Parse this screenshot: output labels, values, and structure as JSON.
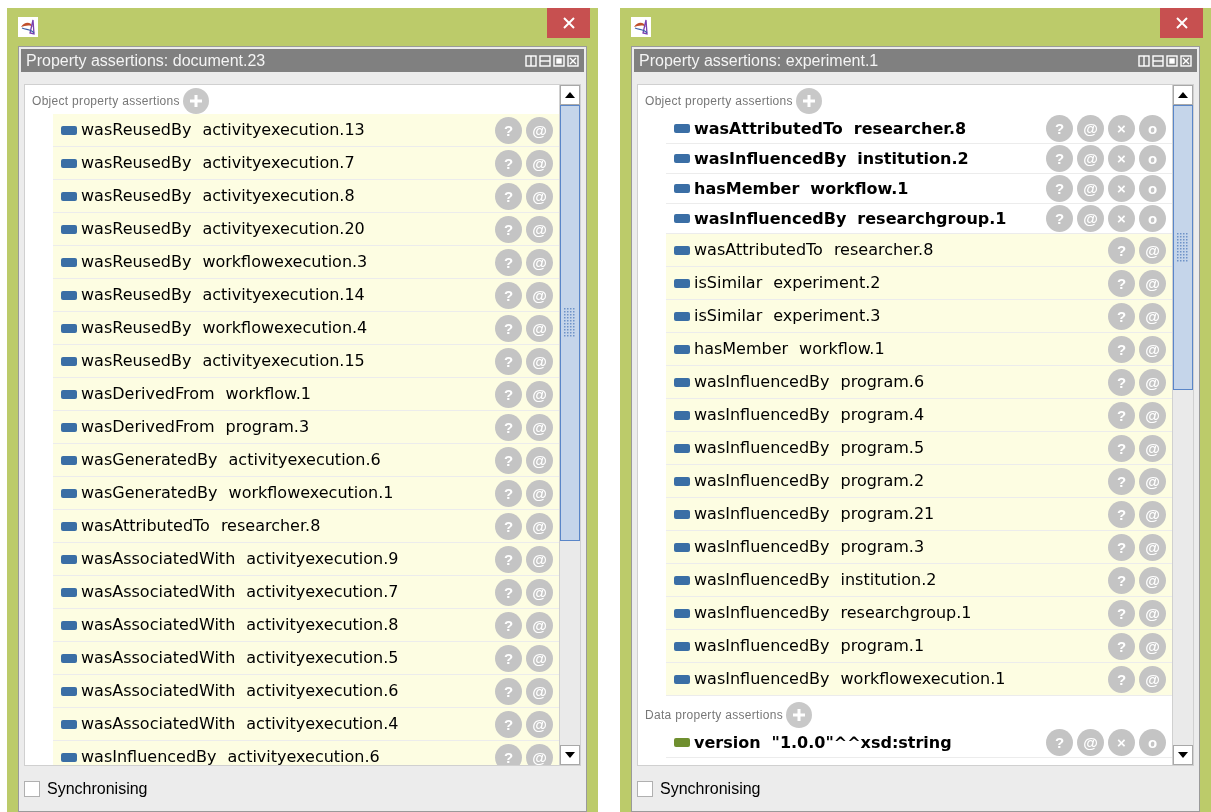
{
  "windows": [
    {
      "title": "Property assertions: document.23",
      "sections": [
        {
          "heading": "Object property assertions",
          "kind": "object",
          "rows": [
            {
              "property": "wasReusedBy",
              "value": "activityexecution.13",
              "asserted": false,
              "buttons": [
                "?",
                "@"
              ]
            },
            {
              "property": "wasReusedBy",
              "value": "activityexecution.7",
              "asserted": false,
              "buttons": [
                "?",
                "@"
              ]
            },
            {
              "property": "wasReusedBy",
              "value": "activityexecution.8",
              "asserted": false,
              "buttons": [
                "?",
                "@"
              ]
            },
            {
              "property": "wasReusedBy",
              "value": "activityexecution.20",
              "asserted": false,
              "buttons": [
                "?",
                "@"
              ]
            },
            {
              "property": "wasReusedBy",
              "value": "workflowexecution.3",
              "asserted": false,
              "buttons": [
                "?",
                "@"
              ]
            },
            {
              "property": "wasReusedBy",
              "value": "activityexecution.14",
              "asserted": false,
              "buttons": [
                "?",
                "@"
              ]
            },
            {
              "property": "wasReusedBy",
              "value": "workflowexecution.4",
              "asserted": false,
              "buttons": [
                "?",
                "@"
              ]
            },
            {
              "property": "wasReusedBy",
              "value": "activityexecution.15",
              "asserted": false,
              "buttons": [
                "?",
                "@"
              ]
            },
            {
              "property": "wasDerivedFrom",
              "value": "workflow.1",
              "asserted": false,
              "buttons": [
                "?",
                "@"
              ]
            },
            {
              "property": "wasDerivedFrom",
              "value": "program.3",
              "asserted": false,
              "buttons": [
                "?",
                "@"
              ]
            },
            {
              "property": "wasGeneratedBy",
              "value": "activityexecution.6",
              "asserted": false,
              "buttons": [
                "?",
                "@"
              ]
            },
            {
              "property": "wasGeneratedBy",
              "value": "workflowexecution.1",
              "asserted": false,
              "buttons": [
                "?",
                "@"
              ]
            },
            {
              "property": "wasAttributedTo",
              "value": "researcher.8",
              "asserted": false,
              "buttons": [
                "?",
                "@"
              ]
            },
            {
              "property": "wasAssociatedWith",
              "value": "activityexecution.9",
              "asserted": false,
              "buttons": [
                "?",
                "@"
              ]
            },
            {
              "property": "wasAssociatedWith",
              "value": "activityexecution.7",
              "asserted": false,
              "buttons": [
                "?",
                "@"
              ]
            },
            {
              "property": "wasAssociatedWith",
              "value": "activityexecution.8",
              "asserted": false,
              "buttons": [
                "?",
                "@"
              ]
            },
            {
              "property": "wasAssociatedWith",
              "value": "activityexecution.5",
              "asserted": false,
              "buttons": [
                "?",
                "@"
              ]
            },
            {
              "property": "wasAssociatedWith",
              "value": "activityexecution.6",
              "asserted": false,
              "buttons": [
                "?",
                "@"
              ]
            },
            {
              "property": "wasAssociatedWith",
              "value": "activityexecution.4",
              "asserted": false,
              "buttons": [
                "?",
                "@"
              ]
            },
            {
              "property": "wasInfluencedBy",
              "value": "activityexecution.6",
              "asserted": false,
              "buttons": [
                "?",
                "@"
              ]
            }
          ]
        }
      ],
      "footer": {
        "label": "Synchronising",
        "checked": false
      }
    },
    {
      "title": "Property assertions: experiment.1",
      "sections": [
        {
          "heading": "Object property assertions",
          "kind": "object",
          "rows": [
            {
              "property": "wasAttributedTo",
              "value": "researcher.8",
              "asserted": true,
              "buttons": [
                "?",
                "@",
                "×",
                "o"
              ]
            },
            {
              "property": "wasInfluencedBy",
              "value": "institution.2",
              "asserted": true,
              "buttons": [
                "?",
                "@",
                "×",
                "o"
              ]
            },
            {
              "property": "hasMember",
              "value": "workflow.1",
              "asserted": true,
              "buttons": [
                "?",
                "@",
                "×",
                "o"
              ]
            },
            {
              "property": "wasInfluencedBy",
              "value": "researchgroup.1",
              "asserted": true,
              "buttons": [
                "?",
                "@",
                "×",
                "o"
              ]
            },
            {
              "property": "wasAttributedTo",
              "value": "researcher.8",
              "asserted": false,
              "buttons": [
                "?",
                "@"
              ]
            },
            {
              "property": "isSimilar",
              "value": "experiment.2",
              "asserted": false,
              "buttons": [
                "?",
                "@"
              ]
            },
            {
              "property": "isSimilar",
              "value": "experiment.3",
              "asserted": false,
              "buttons": [
                "?",
                "@"
              ]
            },
            {
              "property": "hasMember",
              "value": "workflow.1",
              "asserted": false,
              "buttons": [
                "?",
                "@"
              ]
            },
            {
              "property": "wasInfluencedBy",
              "value": "program.6",
              "asserted": false,
              "buttons": [
                "?",
                "@"
              ]
            },
            {
              "property": "wasInfluencedBy",
              "value": "program.4",
              "asserted": false,
              "buttons": [
                "?",
                "@"
              ]
            },
            {
              "property": "wasInfluencedBy",
              "value": "program.5",
              "asserted": false,
              "buttons": [
                "?",
                "@"
              ]
            },
            {
              "property": "wasInfluencedBy",
              "value": "program.2",
              "asserted": false,
              "buttons": [
                "?",
                "@"
              ]
            },
            {
              "property": "wasInfluencedBy",
              "value": "program.21",
              "asserted": false,
              "buttons": [
                "?",
                "@"
              ]
            },
            {
              "property": "wasInfluencedBy",
              "value": "program.3",
              "asserted": false,
              "buttons": [
                "?",
                "@"
              ]
            },
            {
              "property": "wasInfluencedBy",
              "value": "institution.2",
              "asserted": false,
              "buttons": [
                "?",
                "@"
              ]
            },
            {
              "property": "wasInfluencedBy",
              "value": "researchgroup.1",
              "asserted": false,
              "buttons": [
                "?",
                "@"
              ]
            },
            {
              "property": "wasInfluencedBy",
              "value": "program.1",
              "asserted": false,
              "buttons": [
                "?",
                "@"
              ]
            },
            {
              "property": "wasInfluencedBy",
              "value": "workflowexecution.1",
              "asserted": false,
              "buttons": [
                "?",
                "@"
              ]
            }
          ]
        },
        {
          "heading": "Data property assertions",
          "kind": "data",
          "rows": [
            {
              "property": "version",
              "value": "\"1.0.0\"^^xsd:string",
              "asserted": true,
              "buttons": [
                "?",
                "@",
                "×",
                "o"
              ]
            }
          ]
        }
      ],
      "footer": {
        "label": "Synchronising",
        "checked": false
      }
    }
  ]
}
